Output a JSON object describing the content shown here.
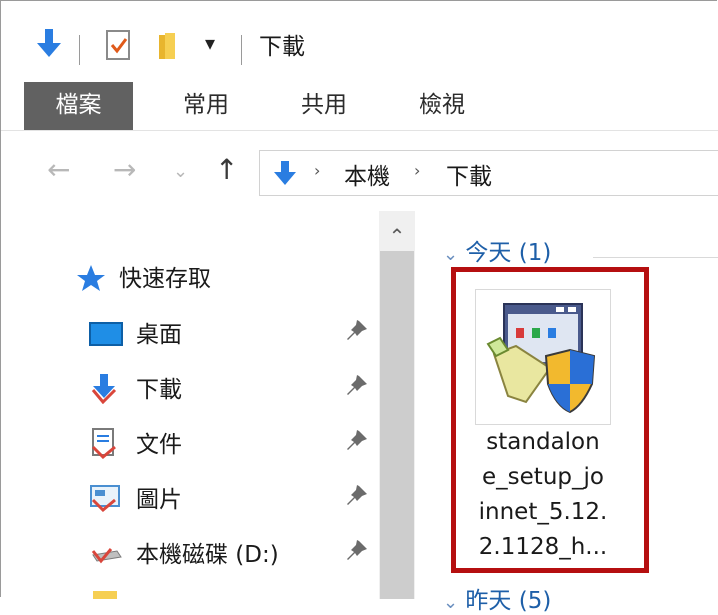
{
  "window": {
    "title": "下載"
  },
  "ribbon": {
    "tabs": [
      "檔案",
      "常用",
      "共用",
      "檢視"
    ]
  },
  "address": {
    "crumbs": [
      "本機",
      "下載"
    ]
  },
  "nav_pane": {
    "quick_access_label": "快速存取",
    "items": [
      {
        "label": "桌面",
        "icon": "desktop-icon",
        "pinned": true
      },
      {
        "label": "下載",
        "icon": "downloads-icon",
        "pinned": true
      },
      {
        "label": "文件",
        "icon": "documents-icon",
        "pinned": true
      },
      {
        "label": "圖片",
        "icon": "pictures-icon",
        "pinned": true
      },
      {
        "label": "本機磁碟 (D:)",
        "icon": "drive-icon",
        "pinned": true
      }
    ]
  },
  "content": {
    "groups": [
      {
        "label": "今天 (1)"
      },
      {
        "label": "昨天 (5)"
      }
    ],
    "files": [
      {
        "name": "standalone_setup_joinnet_5.12.2.1128_h...",
        "lines": [
          "standalon",
          "e_setup_jo",
          "innet_5.12.",
          "2.1128_h..."
        ],
        "icon": "installer-shield-icon"
      }
    ]
  },
  "colors": {
    "accent_blue": "#1e5fa8",
    "file_tab": "#616161",
    "highlight": "#b50f10"
  }
}
